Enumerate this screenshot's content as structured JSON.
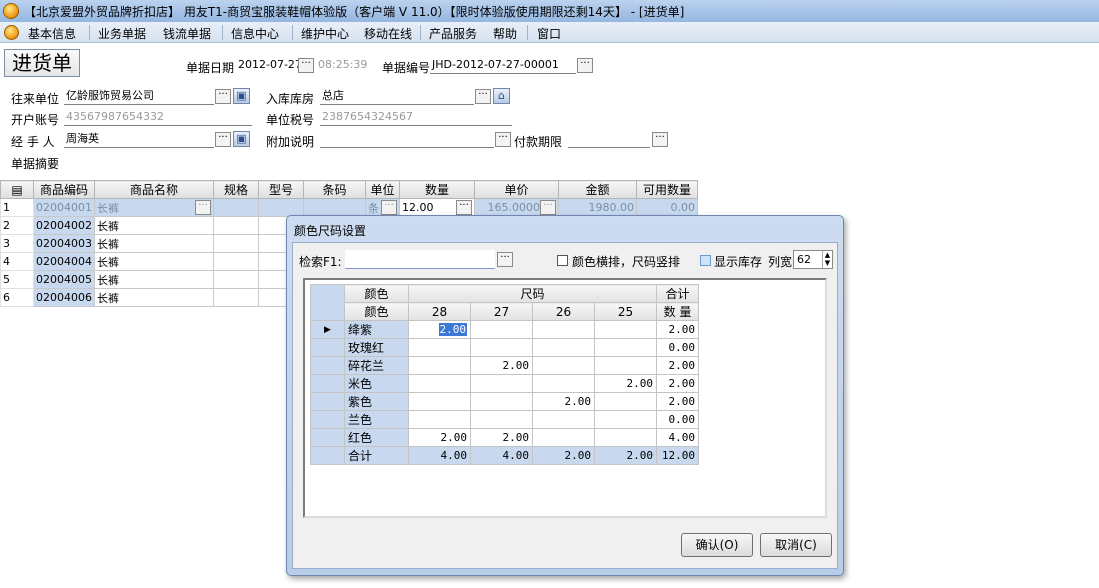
{
  "window": {
    "title": "【北京爱盟外贸品牌折扣店】 用友T1-商贸宝服装鞋帽体验版（客户端 V 11.0）【限时体验版使用期限还剩14天】 - [进货单]"
  },
  "menu": [
    "基本信息",
    "业务单据",
    "钱流单据",
    "信息中心",
    "维护中心",
    "移动在线",
    "产品服务",
    "帮助",
    "窗口"
  ],
  "form": {
    "doc_title": "进货单",
    "date_label": "单据日期",
    "date_value": "2012-07-27",
    "time_value": "08:25:39",
    "number_label": "单据编号",
    "number_value": "JHD-2012-07-27-00001",
    "partner_label": "往来单位",
    "partner_value": "亿龄服饰贸易公司",
    "warehouse_label": "入库库房",
    "warehouse_value": "总店",
    "account_label": "开户账号",
    "account_value": "43567987654332",
    "tax_label": "单位税号",
    "tax_value": "2387654324567",
    "handler_label": "经 手 人",
    "handler_value": "周海英",
    "note_label": "附加说明",
    "payterm_label": "付款期限",
    "summary_label": "单据摘要"
  },
  "grid": {
    "headers": [
      "商品编码",
      "商品名称",
      "规格",
      "型号",
      "条码",
      "单位",
      "数量",
      "单价",
      "金额",
      "可用数量"
    ],
    "rows": [
      {
        "n": "1",
        "code": "02004001",
        "name": "长裤",
        "unit": "条",
        "qty": "12.00",
        "price": "165.0000",
        "amount": "1980.00",
        "avail": "0.00"
      },
      {
        "n": "2",
        "code": "02004002",
        "name": "长裤"
      },
      {
        "n": "3",
        "code": "02004003",
        "name": "长裤"
      },
      {
        "n": "4",
        "code": "02004004",
        "name": "长裤"
      },
      {
        "n": "5",
        "code": "02004005",
        "name": "长裤"
      },
      {
        "n": "6",
        "code": "02004006",
        "name": "长裤"
      }
    ]
  },
  "dialog": {
    "title": "颜色尺码设置",
    "search_label": "检索F1:",
    "check1_label": "颜色横排，尺码竖排",
    "check2_label": "显示库存",
    "colwidth_label": "列宽",
    "colwidth_value": "62",
    "table": {
      "h_color": "颜色",
      "h_size": "尺码",
      "h_total": "合计",
      "sub_color": "颜色",
      "sub_total": "数 量",
      "sizes": [
        "28",
        "27",
        "26",
        "25"
      ],
      "rows": [
        {
          "color": "绛紫",
          "v": [
            "2.00",
            "",
            "",
            ""
          ],
          "total": "2.00"
        },
        {
          "color": "玫瑰红",
          "v": [
            "",
            "",
            "",
            ""
          ],
          "total": "0.00"
        },
        {
          "color": "碎花兰",
          "v": [
            "",
            "2.00",
            "",
            ""
          ],
          "total": "2.00"
        },
        {
          "color": "米色",
          "v": [
            "",
            "",
            "",
            "2.00"
          ],
          "total": "2.00"
        },
        {
          "color": "紫色",
          "v": [
            "",
            "",
            "2.00",
            ""
          ],
          "total": "2.00"
        },
        {
          "color": "兰色",
          "v": [
            "",
            "",
            "",
            ""
          ],
          "total": "0.00"
        },
        {
          "color": "红色",
          "v": [
            "2.00",
            "2.00",
            "",
            ""
          ],
          "total": "4.00"
        },
        {
          "color": "合计",
          "v": [
            "4.00",
            "4.00",
            "2.00",
            "2.00"
          ],
          "total": "12.00"
        }
      ]
    },
    "ok_label": "确认(O)",
    "cancel_label": "取消(C)"
  }
}
